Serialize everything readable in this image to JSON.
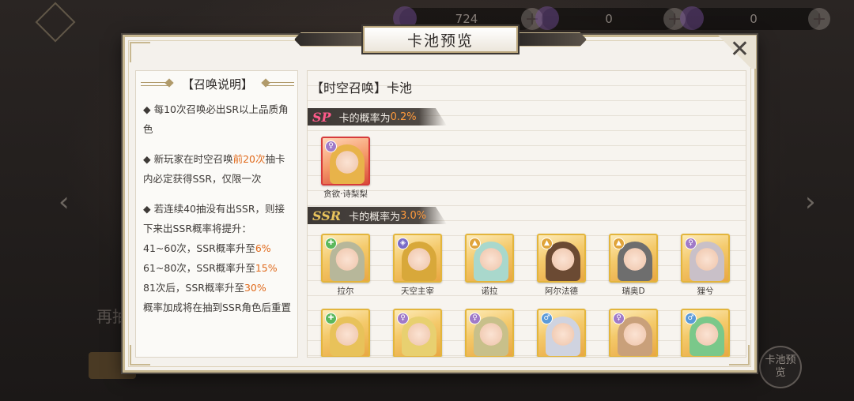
{
  "background": {
    "resources": [
      {
        "value": "724",
        "plus": "+"
      },
      {
        "value": "0",
        "plus": "+"
      },
      {
        "value": "0",
        "plus": "+"
      }
    ],
    "bg_text": "再抽",
    "preview_button": "卡池预览",
    "arrow_left": "‹",
    "arrow_right": "›"
  },
  "modal": {
    "title": "卡池预览",
    "close": "✕"
  },
  "rules": {
    "header": "【召唤说明】",
    "r1": "◆ 每10次召唤必出SR以上品质角色",
    "r2_pre": "◆ 新玩家在时空召唤",
    "r2_hl": "前20次",
    "r2_post": "抽卡内必定获得SSR，仅限一次",
    "r3": "◆ 若连续40抽没有出SSR，则接下来出SSR概率将提升：",
    "r4_pre": "41~60次，SSR概率升至",
    "r4_hl": "6%",
    "r5_pre": "61~80次，SSR概率升至",
    "r5_hl": "15%",
    "r6_pre": "81次后，SSR概率升至",
    "r6_hl": "30%",
    "r7": "概率加成将在抽到SSR角色后重置"
  },
  "pool": {
    "title": "【时空召唤】卡池",
    "sp": {
      "rarity": "SP",
      "label": "卡的概率为",
      "rate": "0.2%"
    },
    "ssr": {
      "rarity": "SSR",
      "label": "卡的概率为",
      "rate": "3.0%"
    },
    "sp_cards": [
      {
        "name": "贪欲·诗梨梨",
        "element": "♀",
        "element_color": "#a07ac8",
        "hair": "#e8b34a"
      }
    ],
    "ssr_cards": [
      {
        "name": "拉尔",
        "element": "✚",
        "element_color": "#5cb85c",
        "hair": "#b7b79a"
      },
      {
        "name": "天空主宰",
        "element": "◈",
        "element_color": "#7a6cc8",
        "hair": "#d8a83a"
      },
      {
        "name": "诺拉",
        "element": "▲",
        "element_color": "#e0a43a",
        "hair": "#a9d8cc"
      },
      {
        "name": "阿尔法德",
        "element": "▲",
        "element_color": "#e0a43a",
        "hair": "#6b4a33"
      },
      {
        "name": "瑞奥D",
        "element": "▲",
        "element_color": "#e0a43a",
        "hair": "#6e6e6e"
      },
      {
        "name": "狸兮",
        "element": "♀",
        "element_color": "#a07ac8",
        "hair": "#c9c0c8"
      },
      {
        "name": "",
        "element": "✚",
        "element_color": "#5cb85c",
        "hair": "#e8c25a"
      },
      {
        "name": "",
        "element": "♀",
        "element_color": "#a07ac8",
        "hair": "#e8d070"
      },
      {
        "name": "",
        "element": "♀",
        "element_color": "#a07ac8",
        "hair": "#c8c08a"
      },
      {
        "name": "",
        "element": "♂",
        "element_color": "#5a9ad8",
        "hair": "#cfd3e0"
      },
      {
        "name": "",
        "element": "♀",
        "element_color": "#a07ac8",
        "hair": "#c9a07a"
      },
      {
        "name": "",
        "element": "♂",
        "element_color": "#5a9ad8",
        "hair": "#7ac88a"
      }
    ]
  }
}
